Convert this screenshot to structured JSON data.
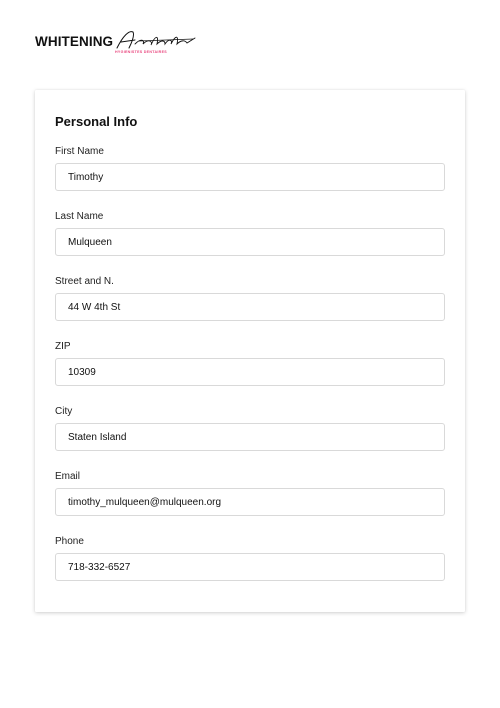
{
  "brand": {
    "name": "WHITENING",
    "script": "Artists",
    "tagline": "HYGIENISTES DENTAIRES",
    "accent_color": "#e9467e"
  },
  "form": {
    "section_title": "Personal Info",
    "fields": [
      {
        "label": "First Name",
        "value": "Timothy"
      },
      {
        "label": "Last Name",
        "value": "Mulqueen"
      },
      {
        "label": "Street and N.",
        "value": "44 W 4th St"
      },
      {
        "label": "ZIP",
        "value": "10309"
      },
      {
        "label": "City",
        "value": "Staten Island"
      },
      {
        "label": "Email",
        "value": "timothy_mulqueen@mulqueen.org"
      },
      {
        "label": "Phone",
        "value": "718-332-6527"
      }
    ]
  }
}
